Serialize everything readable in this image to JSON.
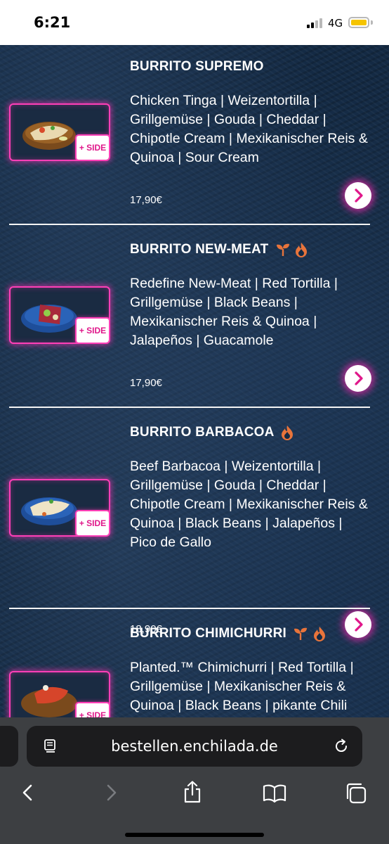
{
  "status_bar": {
    "time": "6:21",
    "network": "4G",
    "battery_color": "#f5c400"
  },
  "menu": {
    "accent_color": "#ff3fb7",
    "side_badge_label": "+ SIDE",
    "items": [
      {
        "title": "BURRITO SUPREMO",
        "icons": [],
        "description": "Chicken Tinga | Weizentortilla | Grillgemüse | Gouda | Cheddar | Chipotle Cream | Mexikanischer Reis & Quinoa | Sour Cream",
        "price": "17,90€"
      },
      {
        "title": "BURRITO NEW-MEAT",
        "icons": [
          "sprout-icon",
          "flame-icon"
        ],
        "description": "Redefine New-Meat | Red Tortilla | Grillgemüse | Black Beans | Mexikanischer Reis & Quinoa | Jalapeños | Guacamole",
        "price": "17,90€"
      },
      {
        "title": "BURRITO BARBACOA",
        "icons": [
          "flame-icon"
        ],
        "description": "Beef Barbacoa | Weizentortilla | Grillgemüse | Gouda | Cheddar | Chipotle Cream | Mexikanischer Reis & Quinoa | Black Beans | Jalapeños | Pico de Gallo",
        "price": "18,90€"
      },
      {
        "title": "BURRITO CHIMICHURRI",
        "icons": [
          "sprout-icon",
          "flame-icon"
        ],
        "description": "Planted.™ Chimichurri | Red Tortilla | Grillgemüse | Mexikanischer Reis & Quinoa | Black Beans | pikante Chili",
        "price": ""
      }
    ]
  },
  "browser": {
    "url": "bestellen.enchilada.de",
    "toolbar": [
      "back-icon",
      "forward-icon",
      "share-icon",
      "bookmarks-icon",
      "tabs-icon"
    ]
  }
}
